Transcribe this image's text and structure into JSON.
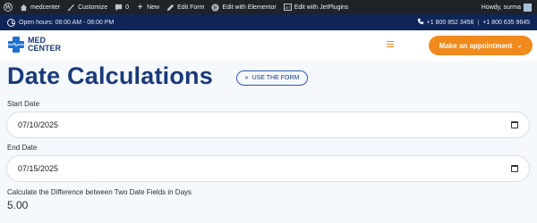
{
  "adminbar": {
    "site_name": "medcenter",
    "customize": "Customize",
    "comments_count": "0",
    "new": "New",
    "edit_form": "Edit Form",
    "edit_elementor": "Edit with Elementor",
    "edit_jetplugins": "Edit with JetPlugins",
    "howdy": "Howdy, surma"
  },
  "topbar": {
    "hours": "Open hours: 08:00 AM - 08:00 PM",
    "phone1": "+1 800 852 3456",
    "separator": "|",
    "phone2": "+1 800 635 9645"
  },
  "header": {
    "logo_line1": "MED",
    "logo_line2": "CENTER",
    "appointment_label": "Make an appointment"
  },
  "main": {
    "title": "Date Calculations",
    "use_form_label": "USE THE FORM",
    "start_label": "Start Date",
    "start_value": "07/10/2025",
    "end_label": "End Date",
    "end_value": "07/15/2025",
    "calc_label": "Calculate the Difference between Two Date Fields in Days",
    "calc_value": "5.00"
  },
  "colors": {
    "adminbar": "#1d2327",
    "topbar": "#0f2557",
    "brand_blue": "#1a3a7a",
    "accent_orange": "#f08a1d",
    "page_bg": "#f5f9fd"
  },
  "icons": [
    "wordpress-icon",
    "home-icon",
    "brush-icon",
    "comment-icon",
    "plus-icon",
    "pencil-icon",
    "elementor-icon",
    "jet-icon",
    "clock-icon",
    "phone-icon",
    "menu-icon",
    "chevron-down-icon",
    "double-chevron-right-icon",
    "calendar-icon"
  ]
}
